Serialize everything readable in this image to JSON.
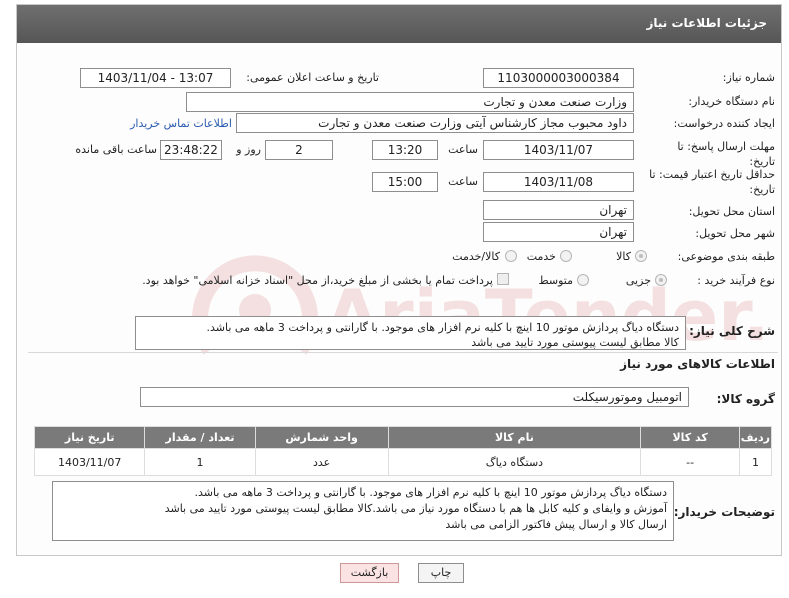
{
  "header": {
    "title": "جزئیات اطلاعات نیاز"
  },
  "form": {
    "need_number": {
      "label": "شماره نیاز:",
      "value": "1103000003000384"
    },
    "announce_datetime": {
      "label": "تاریخ و ساعت اعلان عمومی:",
      "value": "1403/11/04 - 13:07"
    },
    "buyer_org": {
      "label": "نام دستگاه خریدار:",
      "value": "وزارت صنعت معدن و تجارت"
    },
    "requester": {
      "label": "ایجاد کننده درخواست:",
      "value": "داود محبوب مجاز کارشناس آیتی وزارت صنعت معدن و تجارت",
      "contact_link": "اطلاعات تماس خریدار"
    },
    "reply_deadline": {
      "label": "مهلت ارسال پاسخ: تا تاریخ:",
      "date": "1403/11/07",
      "time_label": "ساعت",
      "time": "13:20",
      "days": "2",
      "days_label": "روز و",
      "remaining": "23:48:22",
      "remaining_label": "ساعت باقی مانده"
    },
    "price_validity": {
      "label": "حداقل تاریخ اعتبار قیمت: تا تاریخ:",
      "date": "1403/11/08",
      "time_label": "ساعت",
      "time": "15:00"
    },
    "province": {
      "label": "استان محل تحویل:",
      "value": "تهران"
    },
    "city": {
      "label": "شهر محل تحویل:",
      "value": "تهران"
    },
    "category": {
      "label": "طبقه بندی موضوعی:",
      "options": [
        "کالا",
        "خدمت",
        "کالا/خدمت"
      ],
      "selected": "کالا"
    },
    "purchase_type": {
      "label": "نوع فرآیند خرید :",
      "options": [
        "جزیی",
        "متوسط"
      ],
      "selected": "جزیی",
      "treasury_note": "پرداخت تمام یا بخشی از مبلغ خرید،از محل \"اسناد خزانه اسلامی\" خواهد بود."
    },
    "general_description": {
      "label": "شرح کلی نیاز:",
      "lines": [
        "دستگاه دیاگ پردازش موتور 10 اینچ با کلیه نرم افزار های موجود. با گارانتی و پرداخت 3 ماهه می باشد.",
        "کالا مطابق لیست پیوستی مورد تایید می باشد"
      ]
    }
  },
  "goods_section": {
    "title": "اطلاعات کالاهای مورد نیاز",
    "group_label": "گروه کالا:",
    "group_value": "اتومبیل وموتورسیکلت",
    "columns": [
      "ردیف",
      "کد کالا",
      "نام کالا",
      "واحد شمارش",
      "تعداد / مقدار",
      "تاریخ نیاز"
    ],
    "rows": [
      {
        "row": "1",
        "code": "--",
        "name": "دستگاه دیاگ",
        "unit": "عدد",
        "qty": "1",
        "date": "1403/11/07"
      }
    ]
  },
  "buyer_notes": {
    "label": "توضیحات خریدار:",
    "lines": [
      "دستگاه دیاگ پردازش موتور 10 اینچ با کلیه نرم افزار های موجود. با گارانتی و پرداخت 3 ماهه می باشد.",
      "آموزش و وایفای و کلیه کابل ها هم با دستگاه مورد نیاز می باشد.کالا مطابق لیست پیوستی مورد تایید می باشد",
      "ارسال کالا و ارسال پیش فاکتور الزامی می باشد"
    ]
  },
  "buttons": {
    "print": "چاپ",
    "back": "بازگشت"
  },
  "watermark_text": "AriaTender.net"
}
